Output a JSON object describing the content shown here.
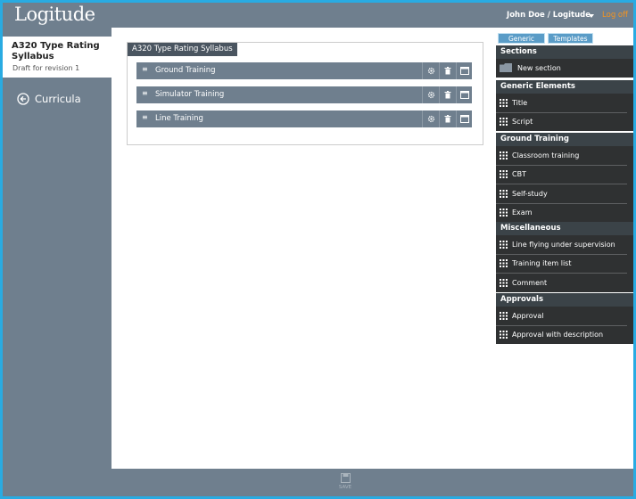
{
  "header": {
    "logo": "Logitude",
    "user": "John Doe / Logitude",
    "logoff": "Log off"
  },
  "sidebar": {
    "title": "A320 Type Rating Syllabus",
    "subtitle": "Draft for revision 1",
    "back_label": "Curricula"
  },
  "main": {
    "tab_title": "A320 Type Rating Syllabus",
    "sections": [
      {
        "label": "Ground Training"
      },
      {
        "label": "Simulator Training"
      },
      {
        "label": "Line Training"
      }
    ]
  },
  "panel": {
    "tabs": {
      "generic": "Generic",
      "templates": "Templates"
    },
    "sections_head": "Sections",
    "new_section": "New section",
    "generic_head": "Generic Elements",
    "generic_items": [
      "Title",
      "Script"
    ],
    "ground_head": "Ground Training",
    "ground_items": [
      "Classroom training",
      "CBT",
      "Self-study",
      "Exam"
    ],
    "misc_head": "Miscellaneous",
    "misc_items": [
      "Line flying under supervision",
      "Training item list",
      "Comment"
    ],
    "approvals_head": "Approvals",
    "approvals_items": [
      "Approval",
      "Approval with description"
    ]
  },
  "footer": {
    "save_label": "SAVE"
  },
  "colors": {
    "accent": "#f7941d",
    "chrome": "#6f7f8e",
    "panel_dark": "#2f3132",
    "border": "#29abe2"
  }
}
